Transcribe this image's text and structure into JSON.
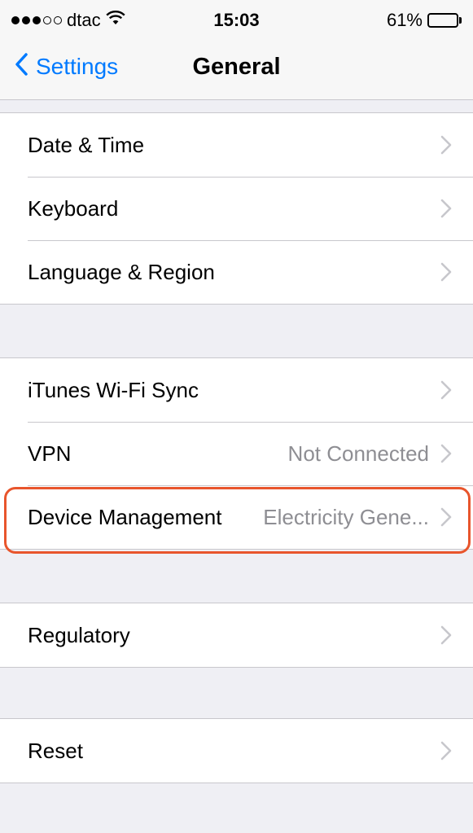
{
  "status_bar": {
    "carrier": "dtac",
    "time": "15:03",
    "battery": "61%",
    "battery_level": 0.61
  },
  "nav": {
    "back_label": "Settings",
    "title": "General"
  },
  "groups": [
    {
      "rows": [
        {
          "label": "Date & Time",
          "detail": ""
        },
        {
          "label": "Keyboard",
          "detail": ""
        },
        {
          "label": "Language & Region",
          "detail": ""
        }
      ]
    },
    {
      "rows": [
        {
          "label": "iTunes Wi-Fi Sync",
          "detail": ""
        },
        {
          "label": "VPN",
          "detail": "Not Connected"
        },
        {
          "label": "Device Management",
          "detail": "Electricity Gene..."
        }
      ]
    },
    {
      "rows": [
        {
          "label": "Regulatory",
          "detail": ""
        }
      ]
    },
    {
      "rows": [
        {
          "label": "Reset",
          "detail": ""
        }
      ]
    }
  ],
  "colors": {
    "accent": "#007aff",
    "highlight": "#e8552c",
    "background": "#efeff4"
  }
}
